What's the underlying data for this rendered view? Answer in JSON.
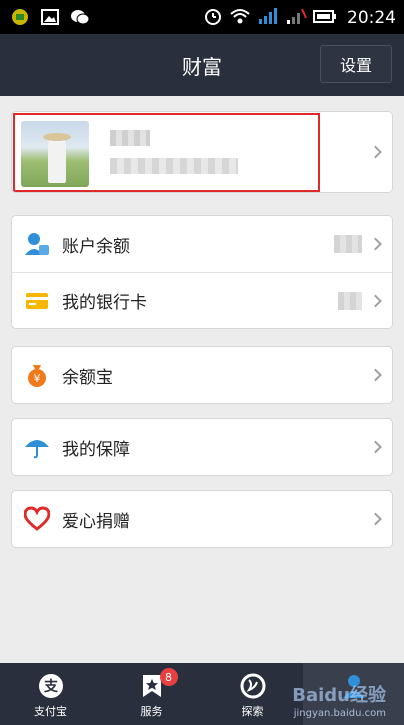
{
  "status_bar": {
    "time": "20:24"
  },
  "header": {
    "title": "财富",
    "settings_label": "设置"
  },
  "menu": {
    "account_balance": "账户余额",
    "bank_card": "我的银行卡",
    "yuebao": "余额宝",
    "protection": "我的保障",
    "donation": "爱心捐赠"
  },
  "tabs": [
    {
      "label": "支付宝"
    },
    {
      "label": "服务",
      "badge": "8"
    },
    {
      "label": "探索"
    },
    {
      "label": "财富"
    }
  ],
  "watermark": {
    "brand": "Baidu经验",
    "url": "jingyan.baidu.com"
  },
  "colors": {
    "header_bg": "#2a2f3d",
    "highlight_border": "#e02a2a",
    "accent_blue": "#2f8fd8",
    "accent_orange": "#f07a1a",
    "accent_yellow": "#f5b800",
    "accent_red": "#e02a2a"
  }
}
